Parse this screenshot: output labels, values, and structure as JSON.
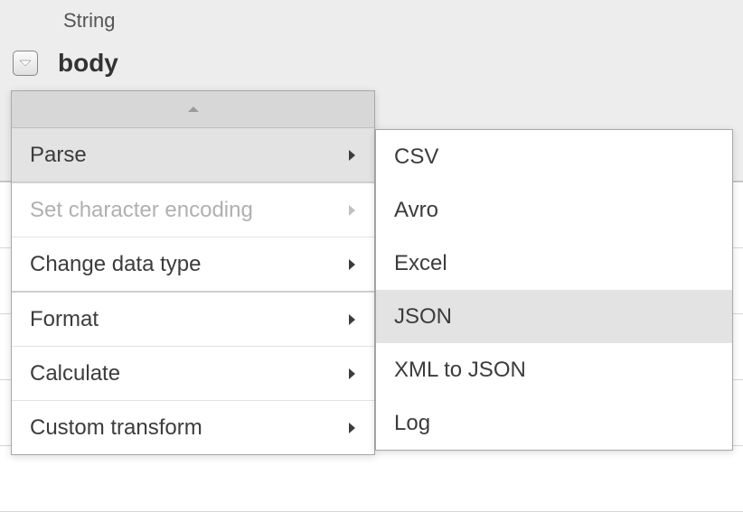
{
  "column": {
    "type_label": "String",
    "name": "body"
  },
  "menu": {
    "items": [
      {
        "label": "Parse",
        "has_submenu": true,
        "disabled": false,
        "hovered": true
      },
      {
        "label": "Set character encoding",
        "has_submenu": true,
        "disabled": true,
        "hovered": false
      },
      {
        "label": "Change data type",
        "has_submenu": true,
        "disabled": false,
        "hovered": false
      },
      {
        "label": "Format",
        "has_submenu": true,
        "disabled": false,
        "hovered": false
      },
      {
        "label": "Calculate",
        "has_submenu": true,
        "disabled": false,
        "hovered": false
      },
      {
        "label": "Custom transform",
        "has_submenu": true,
        "disabled": false,
        "hovered": false
      }
    ]
  },
  "submenu": {
    "items": [
      {
        "label": "CSV",
        "hovered": false
      },
      {
        "label": "Avro",
        "hovered": false
      },
      {
        "label": "Excel",
        "hovered": false
      },
      {
        "label": "JSON",
        "hovered": true
      },
      {
        "label": "XML to JSON",
        "hovered": false
      },
      {
        "label": "Log",
        "hovered": false
      }
    ]
  }
}
